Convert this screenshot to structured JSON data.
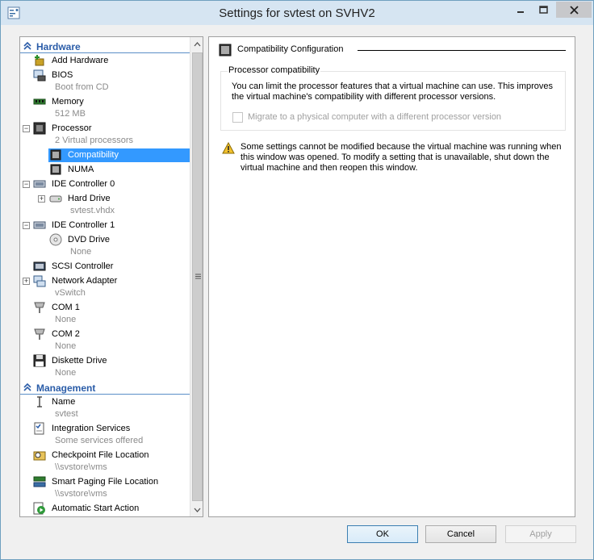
{
  "window": {
    "title": "Settings for svtest on SVHV2"
  },
  "tree": {
    "hardware_label": "Hardware",
    "management_label": "Management",
    "items": [
      {
        "label": "Add Hardware"
      },
      {
        "label": "BIOS",
        "sub": "Boot from CD"
      },
      {
        "label": "Memory",
        "sub": "512 MB"
      },
      {
        "label": "Processor",
        "sub": "2 Virtual processors"
      },
      {
        "label": "Compatibility"
      },
      {
        "label": "NUMA"
      },
      {
        "label": "IDE Controller 0"
      },
      {
        "label": "Hard Drive",
        "sub": "svtest.vhdx"
      },
      {
        "label": "IDE Controller 1"
      },
      {
        "label": "DVD Drive",
        "sub": "None"
      },
      {
        "label": "SCSI Controller"
      },
      {
        "label": "Network Adapter",
        "sub": "vSwitch"
      },
      {
        "label": "COM 1",
        "sub": "None"
      },
      {
        "label": "COM 2",
        "sub": "None"
      },
      {
        "label": "Diskette Drive",
        "sub": "None"
      }
    ],
    "management": [
      {
        "label": "Name",
        "sub": "svtest"
      },
      {
        "label": "Integration Services",
        "sub": "Some services offered"
      },
      {
        "label": "Checkpoint File Location",
        "sub": "\\\\svstore\\vms"
      },
      {
        "label": "Smart Paging File Location",
        "sub": "\\\\svstore\\vms"
      },
      {
        "label": "Automatic Start Action"
      }
    ],
    "selected": "Compatibility"
  },
  "panel": {
    "header": "Compatibility Configuration",
    "group_title": "Processor compatibility",
    "group_desc": "You can limit the processor features that a virtual machine can use. This improves the virtual machine's compatibility with different processor versions.",
    "checkbox_label": "Migrate to a physical computer with a different processor version",
    "checkbox_checked": false,
    "warning": "Some settings cannot be modified because the virtual machine was running when this window was opened. To modify a setting that is unavailable, shut down the virtual machine and then reopen this window."
  },
  "buttons": {
    "ok": "OK",
    "cancel": "Cancel",
    "apply": "Apply"
  },
  "colors": {
    "accent": "#3399ff",
    "section": "#2a5ca8",
    "titlebar": "#d6e5f2"
  }
}
